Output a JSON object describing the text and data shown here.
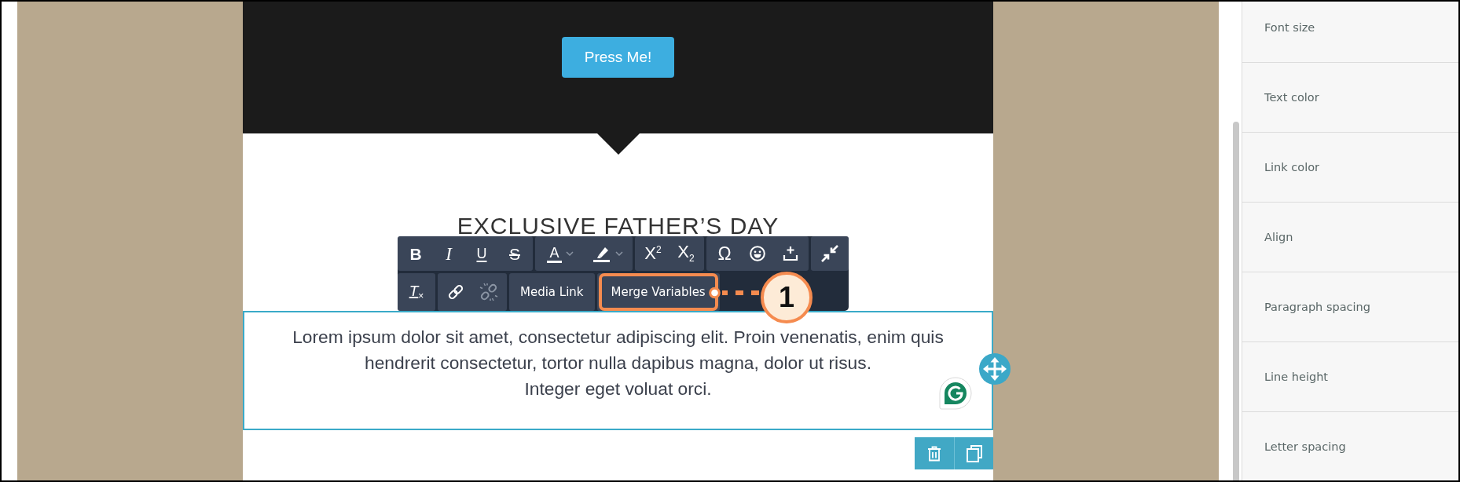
{
  "canvas": {
    "header": {
      "button": "Press Me!"
    },
    "heading": "EXCLUSIVE FATHER’S DAY",
    "text_block": {
      "selected": true,
      "paragraphs": [
        "Lorem ipsum dolor sit amet, consectetur adipiscing elit. Proin venenatis, enim quis hendrerit consectetur, tortor nulla dapibus magna, dolor ut risus.",
        "Integer eget voluat orci."
      ]
    }
  },
  "toolbar": {
    "rows": [
      {
        "groups": [
          {
            "buttons": [
              {
                "kind": "bold",
                "label": "B",
                "disabled": false,
                "highlighted": false
              },
              {
                "kind": "italic",
                "label": "I",
                "disabled": false,
                "highlighted": false
              },
              {
                "kind": "underline",
                "label": "U",
                "disabled": false,
                "highlighted": false
              },
              {
                "kind": "strike",
                "label": "S",
                "disabled": false,
                "highlighted": false
              }
            ]
          },
          {
            "buttons": [
              {
                "kind": "fontcolor",
                "label": "A",
                "disabled": false,
                "highlighted": false
              },
              {
                "kind": "highlight",
                "disabled": false,
                "highlighted": false
              }
            ]
          },
          {
            "buttons": [
              {
                "kind": "superscript",
                "label": "X$^{2}$",
                "disabled": false,
                "highlighted": false
              },
              {
                "kind": "subscript",
                "label": "X$_{2}$",
                "disabled": false,
                "highlighted": false
              }
            ]
          },
          {
            "buttons": [
              {
                "kind": "symbol",
                "label": "Ω",
                "disabled": false,
                "highlighted": false
              },
              {
                "kind": "emoji",
                "disabled": false,
                "highlighted": false
              },
              {
                "kind": "insert",
                "disabled": false,
                "highlighted": false
              }
            ]
          },
          {
            "buttons": [
              {
                "kind": "collapse",
                "disabled": false,
                "highlighted": false
              }
            ]
          }
        ]
      },
      {
        "groups": [
          {
            "buttons": [
              {
                "kind": "clearformat",
                "label": "T$_{×}$",
                "disabled": false,
                "highlighted": false
              }
            ]
          },
          {
            "buttons": [
              {
                "kind": "link",
                "disabled": false,
                "highlighted": false
              },
              {
                "kind": "unlink",
                "disabled": true,
                "highlighted": false
              }
            ]
          },
          {
            "buttons": [
              {
                "kind": "text",
                "label": "Media Link",
                "disabled": false,
                "highlighted": false
              }
            ]
          },
          {
            "buttons": [
              {
                "kind": "text",
                "label": "Merge Variables",
                "disabled": false,
                "highlighted": true
              }
            ]
          }
        ]
      }
    ]
  },
  "callout": {
    "number": "1"
  },
  "sidebar": {
    "items": [
      "Font size",
      "Text color",
      "Link color",
      "Align",
      "Paragraph spacing",
      "Line height",
      "Letter spacing"
    ]
  }
}
